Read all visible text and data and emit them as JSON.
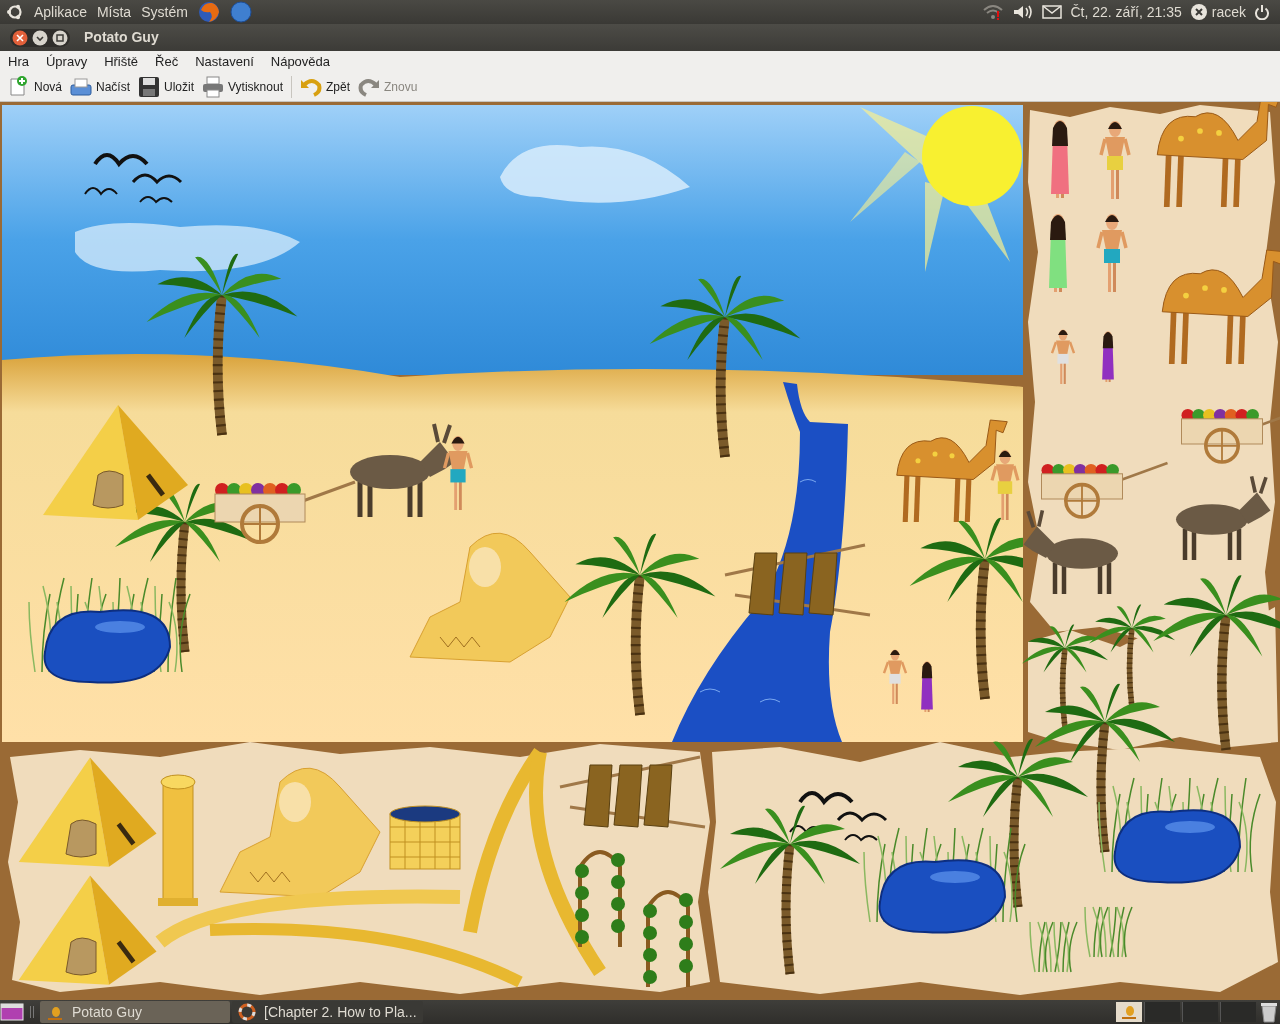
{
  "top_panel": {
    "menus": [
      "Aplikace",
      "Místa",
      "Systém"
    ],
    "clock": "Čt, 22. září, 21:35",
    "user": "racek"
  },
  "window": {
    "title": "Potato Guy"
  },
  "menu_bar": [
    "Hra",
    "Úpravy",
    "Hřiště",
    "Řeč",
    "Nastavení",
    "Nápověda"
  ],
  "toolbar": [
    {
      "kind": "new",
      "label": "Nová",
      "disabled": false
    },
    {
      "kind": "open",
      "label": "Načíst",
      "disabled": false
    },
    {
      "kind": "save",
      "label": "Uložit",
      "disabled": false
    },
    {
      "kind": "print",
      "label": "Vytisknout",
      "disabled": false
    },
    {
      "kind": "undo",
      "label": "Zpět",
      "disabled": false
    },
    {
      "kind": "redo",
      "label": "Znovu",
      "disabled": true
    }
  ],
  "taskbar": [
    {
      "label": "Potato Guy",
      "selected": true
    },
    {
      "label": "[Chapter 2. How to Pla...",
      "selected": false
    }
  ]
}
